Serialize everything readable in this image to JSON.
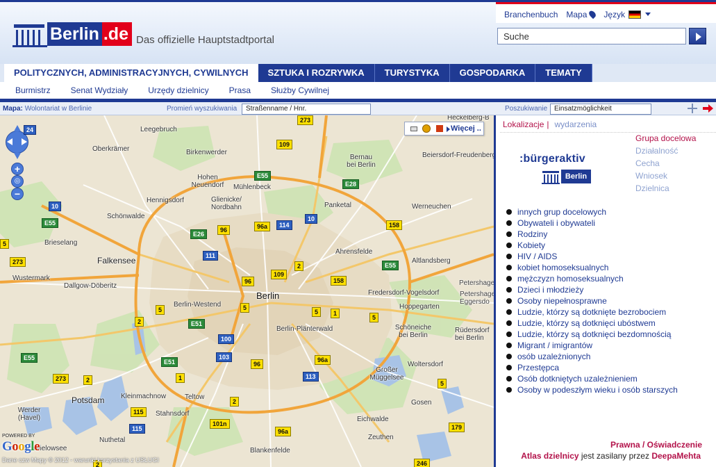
{
  "header": {
    "logo_berlin": "Berlin",
    "logo_de": ".de",
    "tagline": "Das offizielle Hauptstadtportal",
    "links": {
      "branchenbuch": "Branchenbuch",
      "mapa": "Mapa",
      "language": "Język"
    },
    "search_value": "Suche"
  },
  "nav": {
    "tabs": [
      "POLITYCZNYCH, ADMINISTRACYJNYCH, CYWILNYCH",
      "SZTUKA I ROZRYWKA",
      "TURYSTYKA",
      "GOSPODARKA",
      "TEMATY"
    ],
    "subnav": [
      "Burmistrz",
      "Senat Wydziały",
      "Urzędy dzielnicy",
      "Prasa",
      "Służby Cywilnej"
    ]
  },
  "map_toolbar": {
    "mapa_label": "Mapa:",
    "mapa_value": "Wolontariat w Berlinie",
    "radius_label": "Promień wyszukiwania",
    "radius_value": "Straßenname / Hnr.",
    "search_label": "Poszukiwanie",
    "search_value": "Einsatzmöglichkeit"
  },
  "map": {
    "more_button": "Więcej ..",
    "zoom_level_badge": "24",
    "powered_by": "POWERED BY",
    "google": "Google",
    "copyright": "Dane czw Mapy © 2012 - warunki korzystania z USŁUGI",
    "places": {
      "heckelberg": "Heckelberg-B",
      "leegebruch": "Leegebruch",
      "birkenwerder": "Birkenwerder",
      "oberkramer": "Oberkrämer",
      "bernau": "Bernau\nbei Berlin",
      "beiersdorf": "Beiersdorf-Freudenberg",
      "hohen_neuendorf": "Hohen\nNeuendorf",
      "muehlenbeck": "Mühlenbeck",
      "hennigsdorf": "Hennigsdorf",
      "glienicke": "Glienicke/\nNordbahn",
      "panketal": "Panketal",
      "werneuchen": "Werneuchen",
      "schoenwalde": "Schönwalde",
      "brieselang": "Brieselang",
      "ahrensfelde": "Ahrensfelde",
      "falkensee": "Falkensee",
      "altlandsberg": "Altlandsberg",
      "wustermark": "Wustermark",
      "dallgow": "Dallgow-Döberitz",
      "petershagen": "Petershage",
      "fredersdorf": "Fredersdorf-Vogelsdorf",
      "berlin": "Berlin",
      "petershagen2": "Petershage\nEggersdo",
      "berlin_westend": "Berlin-Westend",
      "hoppegarten": "Hoppegarten",
      "berlin_plaenterwald": "Berlin-Plänterwald",
      "schoeneiche": "Schöneiche\nbei Berlin",
      "ruedersdorf": "Rüdersdorf\nbei Berlin",
      "grosser_mueggelsee": "Großer\nMüggelsee",
      "woltersdorf": "Woltersdorf",
      "kleinmachnow": "Kleinmachnow",
      "teltow": "Teltow",
      "potsdam": "Potsdam",
      "werder": "Werder\n(Havel)",
      "stahnsdorf": "Stahnsdorf",
      "gosen": "Gosen",
      "schwielowsee": "Schwielowsee",
      "nuthetal": "Nuthetal",
      "eichwalde": "Eichwalde",
      "zeuthen": "Zeuthen",
      "blankenfelde": "Blankenfelde"
    }
  },
  "panel": {
    "tab_active": "Lokalizacje",
    "tab_separator": "|",
    "tab_inactive": "wydarzenia",
    "logo_text": ":bürgeraktiv",
    "logo_berlin": "Berlin",
    "filters": [
      "Grupa docelowa",
      "Działalność",
      "Cecha",
      "Wniosek",
      "Dzielnica"
    ],
    "groups": [
      "innych grup docelowych",
      "Obywateli i obywateli",
      "Rodziny",
      "Kobiety",
      "HIV / AIDS",
      "kobiet homoseksualnych",
      "mężczyzn homoseksualnych",
      "Dzieci i młodzieży",
      "Osoby niepełnosprawne",
      "Ludzie, którzy są dotknięte bezrobociem",
      "Ludzie, którzy są dotknięci ubóstwem",
      "Ludzie, którzy są dotknięci bezdomnością",
      "Migrant / imigrantów",
      "osób uzależnionych",
      "Przestępca",
      "Osób dotkniętych uzależnieniem",
      "Osoby w podeszłym wieku i osób starszych"
    ],
    "footer_legal": "Prawna / Oświadczenie",
    "footer_atlas": "Atlas dzielnicy",
    "footer_powered": " jest zasilany przez ",
    "footer_deepa": "DeepaMehta"
  },
  "colors": {
    "brand_blue": "#1f3a93",
    "brand_red": "#e2001a",
    "accent_magenta": "#b3124a"
  }
}
